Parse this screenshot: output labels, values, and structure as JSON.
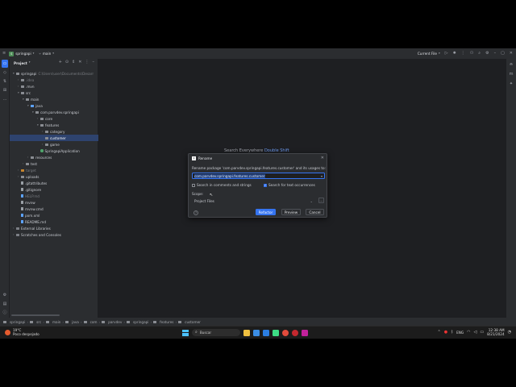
{
  "titlebar": {
    "project_badge": "S",
    "project_name": "springapi",
    "branch": "main",
    "run_config": "Current File"
  },
  "project_panel": {
    "title": "Project",
    "tree": [
      {
        "label": "springapi",
        "suffix": "C:\\Users\\user\\Documents\\Desarr",
        "level": 0,
        "arrow": "▾",
        "icon": "dir"
      },
      {
        "label": ".idea",
        "level": 1,
        "arrow": "›",
        "icon": "dir",
        "dim": true
      },
      {
        "label": ".mvn",
        "level": 1,
        "arrow": "›",
        "icon": "dir"
      },
      {
        "label": "src",
        "level": 1,
        "arrow": "▾",
        "icon": "dir"
      },
      {
        "label": "main",
        "level": 2,
        "arrow": "▾",
        "icon": "dir"
      },
      {
        "label": "java",
        "level": 3,
        "arrow": "▾",
        "icon": "src"
      },
      {
        "label": "com.parvdev.springapi",
        "level": 4,
        "arrow": "▾",
        "icon": "dir"
      },
      {
        "label": "core",
        "level": 5,
        "arrow": "›",
        "icon": "dir"
      },
      {
        "label": "features",
        "level": 5,
        "arrow": "▾",
        "icon": "dir"
      },
      {
        "label": "category",
        "level": 6,
        "arrow": "›",
        "icon": "dir"
      },
      {
        "label": "customer",
        "level": 6,
        "arrow": "",
        "icon": "dir",
        "selected": true
      },
      {
        "label": "game",
        "level": 6,
        "arrow": "›",
        "icon": "dir"
      },
      {
        "label": "SpringapiApplication",
        "level": 5,
        "arrow": "",
        "icon": "cls"
      },
      {
        "label": "resources",
        "level": 3,
        "arrow": "›",
        "icon": "dir"
      },
      {
        "label": "test",
        "level": 2,
        "arrow": "›",
        "icon": "dir"
      },
      {
        "label": "target",
        "level": 1,
        "arrow": "›",
        "icon": "exc",
        "dim": true
      },
      {
        "label": "uploads",
        "level": 1,
        "arrow": "›",
        "icon": "dir"
      },
      {
        "label": ".gitattributes",
        "level": 1,
        "arrow": "",
        "icon": "file"
      },
      {
        "label": ".gitignore",
        "level": 1,
        "arrow": "",
        "icon": "file"
      },
      {
        "label": "HELP.md",
        "level": 1,
        "arrow": "",
        "icon": "md",
        "dim": true
      },
      {
        "label": "mvnw",
        "level": 1,
        "arrow": "",
        "icon": "file"
      },
      {
        "label": "mvnw.cmd",
        "level": 1,
        "arrow": "",
        "icon": "file"
      },
      {
        "label": "pom.xml",
        "level": 1,
        "arrow": "",
        "icon": "md"
      },
      {
        "label": "README.md",
        "level": 1,
        "arrow": "",
        "icon": "md"
      },
      {
        "label": "External Libraries",
        "level": 0,
        "arrow": "›",
        "icon": "lib"
      },
      {
        "label": "Scratches and Consoles",
        "level": 0,
        "arrow": "›",
        "icon": "lib"
      }
    ]
  },
  "editor": {
    "search_hint": "Search Everywhere",
    "search_key": "Double Shift"
  },
  "rename_dialog": {
    "title": "Rename",
    "message": "Rename package 'com.parvdev.springapi.features.customer' and its usages to:",
    "input_value": "com.parvdev.springapi.features.customer",
    "search_comments_label": "Search in comments and strings",
    "search_comments_checked": false,
    "search_text_label": "Search for text occurrences",
    "search_text_checked": true,
    "scope_label": "Scope:",
    "scope_value": "Project Files",
    "refactor_label": "Refactor",
    "preview_label": "Preview",
    "cancel_label": "Cancel"
  },
  "statusbar": {
    "path": [
      "springapi",
      "src",
      "main",
      "java",
      "com",
      "parvdev",
      "springapi",
      "features",
      "customer"
    ]
  },
  "taskbar": {
    "weather_temp": "19°C",
    "weather_desc": "Poco despejado",
    "search_placeholder": "Buscar",
    "lang": "ENG",
    "time": "12:38 AM",
    "date": "8/21/2024"
  }
}
